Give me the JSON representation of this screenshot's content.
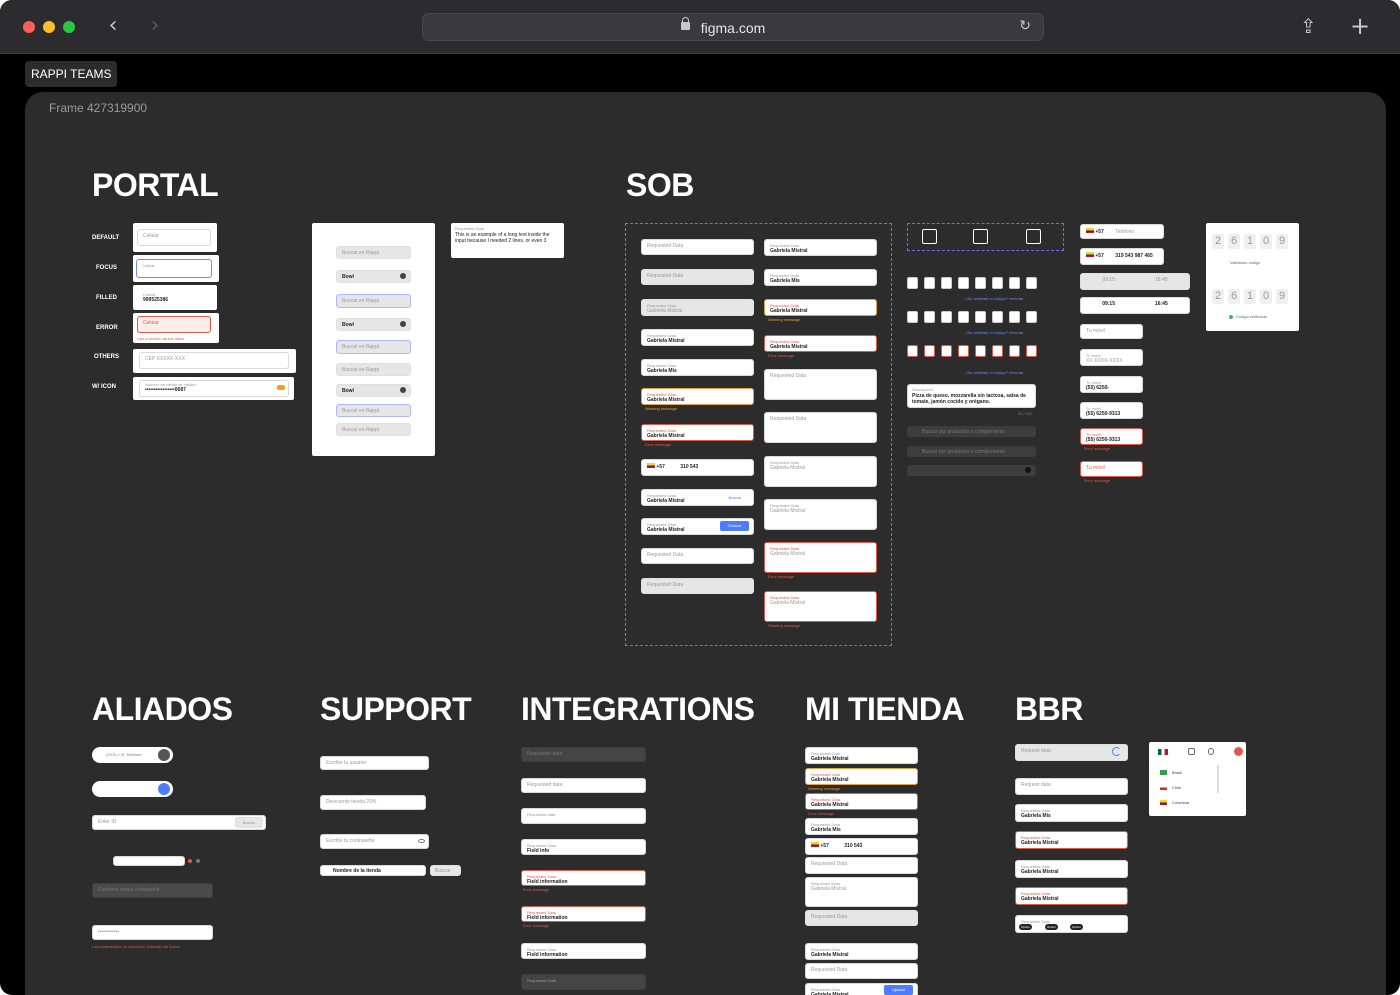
{
  "browser": {
    "url": "figma.com"
  },
  "team": "RAPPI TEAMS",
  "frame_label": "Frame 427319900",
  "headings": {
    "portal": "PORTAL",
    "sob": "SOB",
    "aliados": "ALIADOS",
    "support": "SUPPORT",
    "integrations": "INTEGRATIONS",
    "mi_tienda": "MI TIENDA",
    "bbr": "BBR"
  },
  "portal": {
    "rows": [
      "DEFAULT",
      "FOCUS",
      "FILLED",
      "ERROR",
      "OTHERS",
      "W/ ICON"
    ],
    "default_placeholder": "Celular",
    "focus_label": "Celular",
    "filled_label": "Celular",
    "filled_value": "999525386",
    "error_value": "Celular",
    "error_note": "Ups a versión de tus datos",
    "others_value": "CEP XXXXX-XXX",
    "icon_label": "Número de cartão de crédito",
    "icon_value": "•••••••••••••••••0687",
    "search_placeholder": "Buscar en Rappi",
    "search_value": "Bowl",
    "long_text_label": "Requested Data",
    "long_text": "This is an example of a long text inside the input because I needed 2 lines, or even 3"
  },
  "sob": {
    "requested": "Requested Data",
    "name": "Gabriela Mistral",
    "name_partial": "Gabriela Mis",
    "warning": "Warning message",
    "error": "Error message",
    "phone_code": "+57",
    "phone_value": "310 543",
    "buscar": "Buscar",
    "choose": "Choose",
    "resend": "¿No recibiste el código? reenviar",
    "description_label": "Descripción",
    "description": "Pizza de queso, mozzarella sin lactosa, salsa de tomate, jamón cocido y orégano.",
    "counter": "83 / 400",
    "search_products": "Buscar por productos o complemento",
    "phone_label": "Teléfono",
    "phone_full": "319 543 987 465",
    "time_1": "09:15",
    "time_2": "16:45",
    "mobile": "Tu móvil",
    "mask": "XX XXXX-XXXX",
    "phone_fmt": "(55) 6250-",
    "phone_fmt_full": "(55) 6250-9313",
    "code_digits": [
      "2",
      "6",
      "1",
      "0",
      "9"
    ],
    "validating": "Validando código",
    "verified": "Código verificado"
  },
  "aliados": {
    "phone_placeholder": "(XXX) + N. Teléfono",
    "id_placeholder": "Enter ID",
    "search_btn": "Buscar",
    "confirm_pw": "Confirma nueva contraseña",
    "pw_dots": "••••••••••••",
    "pw_error": "Las contraseñas no coinciden. Inténtalo de nuevo"
  },
  "support": {
    "user": "Escribe tu usuario",
    "discount": "Descuento tienda 20%",
    "password": "Escribe tu contraseña",
    "store_name": "Nombre de la tienda",
    "search": "Buscar"
  },
  "integrations": {
    "requested": "Requested data",
    "requested_cap": "Requested Data",
    "field_info": "Field info",
    "field_information": "Field information",
    "error": "Error message"
  },
  "mi_tienda": {
    "requested": "Requested Data",
    "name": "Gabriela Mistral",
    "name_partial": "Gabriela Mis",
    "warning": "Warning message",
    "error": "Error message",
    "phone_code": "+57",
    "phone_value": "310 543",
    "upload": "Upload"
  },
  "bbr": {
    "requested": "Request data",
    "requested_cap": "Requested Data",
    "name": "Gabriela Mistral",
    "name_partial": "Gabriela Mis",
    "countries": [
      "Brasil",
      "Chile",
      "Colombia"
    ],
    "chip": "Option"
  },
  "colors": {
    "window_bg": "#000000",
    "frame_bg": "#2c2c2c",
    "error": "#e05a4a",
    "accent": "#4d7cfe"
  }
}
